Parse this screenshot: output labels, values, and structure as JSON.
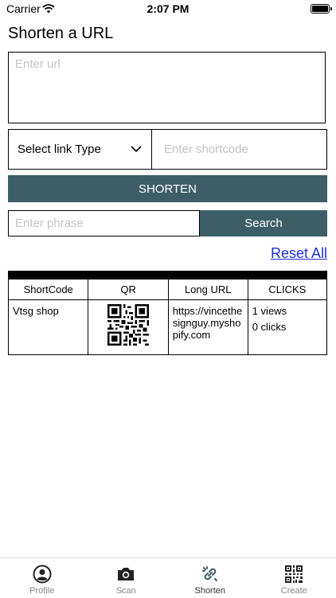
{
  "status_bar": {
    "carrier": "Carrier",
    "time": "2:07 PM"
  },
  "page": {
    "title": "Shorten a URL"
  },
  "form": {
    "url_placeholder": "Enter url",
    "link_type_label": "Select link Type",
    "shortcode_placeholder": "Enter shortcode",
    "shorten_label": "SHORTEN"
  },
  "search": {
    "phrase_placeholder": "Enter phrase",
    "button_label": "Search"
  },
  "reset_label": "Reset All",
  "table": {
    "headers": [
      "ShortCode",
      "QR",
      "Long URL",
      "CLICKS"
    ],
    "rows": [
      {
        "shortcode": "Vtsg shop",
        "long_url": "https://vincethesignguy.myshopify.com",
        "views": "1 views",
        "clicks": "0 clicks"
      }
    ]
  },
  "tabs": [
    {
      "label": "Profile",
      "icon": "person-circle-icon"
    },
    {
      "label": "Scan",
      "icon": "camera-icon"
    },
    {
      "label": "Shorten",
      "icon": "link-icon",
      "active": true
    },
    {
      "label": "Create",
      "icon": "qr-code-icon"
    }
  ],
  "colors": {
    "accent": "#3d5e66",
    "link": "#1f2fd6",
    "placeholder": "#c4c4c4"
  }
}
